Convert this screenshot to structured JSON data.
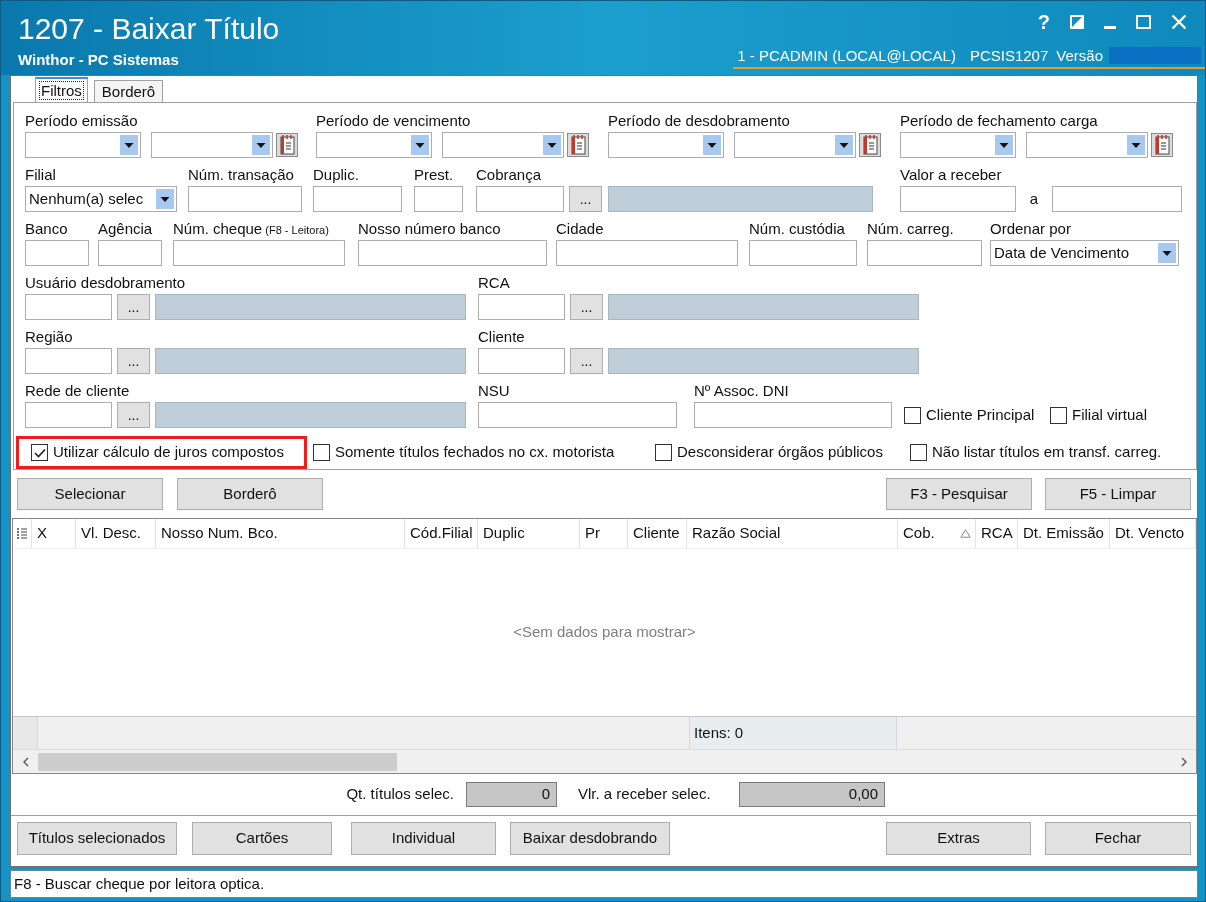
{
  "window": {
    "title": "1207 - Baixar Título",
    "subtitle": "Winthor - PC Sistemas",
    "help": "?",
    "session": "1 - PCADMIN (LOCAL@LOCAL)",
    "program": "PCSIS1207",
    "version_label": "Versão"
  },
  "tabs": [
    {
      "label": "Filtros",
      "selected": true
    },
    {
      "label": "Borderô",
      "selected": false
    }
  ],
  "filters": [
    [
      {
        "kind": "date_range",
        "label": "Período emissão"
      },
      {
        "kind": "date_range",
        "label": "Período de vencimento"
      },
      {
        "kind": "date_range",
        "label": "Período de desdobramento"
      },
      {
        "kind": "date_range",
        "label": "Período de fechamento carga"
      }
    ],
    [
      {
        "kind": "combo",
        "label": "Filial",
        "value": "Nenhum(a) selec"
      },
      {
        "kind": "text",
        "label": "Núm. transação"
      },
      {
        "kind": "text",
        "label": "Duplic."
      },
      {
        "kind": "text",
        "label": "Prest."
      },
      {
        "kind": "lookup",
        "label": "Cobrança",
        "button": "..."
      },
      {
        "kind": "range",
        "label": "Valor a receber",
        "separator": "a"
      }
    ],
    [
      {
        "kind": "text",
        "label": "Banco"
      },
      {
        "kind": "text",
        "label": "Agência"
      },
      {
        "kind": "text",
        "label": "Núm. cheque",
        "note": "(F8 - Leitora)"
      },
      {
        "kind": "text",
        "label": "Nosso número banco"
      },
      {
        "kind": "text",
        "label": "Cidade"
      },
      {
        "kind": "text",
        "label": "Núm. custódia"
      },
      {
        "kind": "text",
        "label": "Núm. carreg."
      },
      {
        "kind": "combo",
        "label": "Ordenar por",
        "value": "Data de Vencimento"
      }
    ],
    [
      {
        "kind": "lookup",
        "label": "Usuário desdobramento",
        "button": "..."
      },
      {
        "kind": "lookup",
        "label": "RCA",
        "button": "..."
      }
    ],
    [
      {
        "kind": "lookup",
        "label": "Região",
        "button": "..."
      },
      {
        "kind": "lookup",
        "label": "Cliente",
        "button": "..."
      }
    ],
    [
      {
        "kind": "lookup",
        "label": "Rede de cliente",
        "button": "..."
      },
      {
        "kind": "text",
        "label": "NSU"
      },
      {
        "kind": "text",
        "label": "Nº Assoc. DNI"
      },
      {
        "kind": "checkbox",
        "label": "Cliente Principal",
        "checked": false
      },
      {
        "kind": "checkbox",
        "label": "Filial virtual",
        "checked": false
      }
    ]
  ],
  "options": [
    {
      "label": "Utilizar cálculo de juros compostos",
      "checked": true,
      "highlighted": true
    },
    {
      "label": "Somente títulos fechados no cx. motorista",
      "checked": false,
      "highlighted": false
    },
    {
      "label": "Desconsiderar órgãos públicos",
      "checked": false,
      "highlighted": false
    },
    {
      "label": "Não listar títulos em transf. carreg.",
      "checked": false,
      "highlighted": false
    }
  ],
  "actions": {
    "left": [
      "Selecionar",
      "Borderô"
    ],
    "right": [
      "F3 - Pesquisar",
      "F5 - Limpar"
    ]
  },
  "grid": {
    "columns": [
      {
        "label": "X",
        "sorted": false
      },
      {
        "label": "Vl. Desc.",
        "sorted": false
      },
      {
        "label": "Nosso Num. Bco.",
        "sorted": false
      },
      {
        "label": "Cód.Filial",
        "sorted": false
      },
      {
        "label": "Duplic",
        "sorted": false
      },
      {
        "label": "Pr",
        "sorted": false
      },
      {
        "label": "Cliente",
        "sorted": false
      },
      {
        "label": "Razão Social",
        "sorted": false
      },
      {
        "label": "Cob.",
        "sorted": true
      },
      {
        "label": "RCA",
        "sorted": false
      },
      {
        "label": "Dt. Emissão",
        "sorted": false
      },
      {
        "label": "Dt. Vencto",
        "sorted": false
      }
    ],
    "empty_message": "<Sem dados para mostrar>",
    "footer": "Itens: 0"
  },
  "summary": [
    {
      "label": "Qt. títulos selec.",
      "value": "0"
    },
    {
      "label": "Vlr. a receber selec.",
      "value": "0,00"
    }
  ],
  "buttons": {
    "left": [
      "Títulos selecionados",
      "Cartões",
      "Individual",
      "Baixar desdobrando"
    ],
    "right": [
      "Extras",
      "Fechar"
    ]
  },
  "status_bar": "F8 - Buscar cheque por leitora optica."
}
